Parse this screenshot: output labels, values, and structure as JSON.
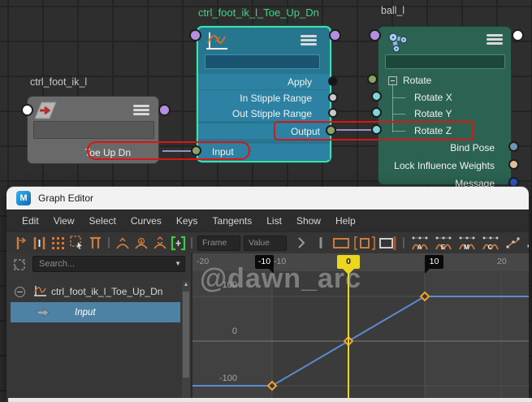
{
  "watermark": "@dawn_arc",
  "colors": {
    "selection_green": "#44e2a2",
    "highlight_red": "#de1414",
    "curve_blue": "#5b8ad0",
    "key_orange": "#f1a525",
    "playhead_yellow": "#ecd61e",
    "connection_lavender": "#9a90c8"
  },
  "icons": {
    "dropdown_caret": "▼",
    "scroll_up": "▲"
  },
  "node_editor": {
    "nodes": {
      "ctrl": {
        "title": "ctrl_foot_ik_l",
        "attr_toe": "Toe Up Dn"
      },
      "anim": {
        "title": "ctrl_foot_ik_l_Toe_Up_Dn",
        "attrs": [
          "Apply",
          "In Stipple Range",
          "Out Stipple Range",
          "Output",
          "Input"
        ]
      },
      "ball": {
        "title": "ball_l",
        "attrs": [
          "Rotate",
          "Rotate X",
          "Rotate Y",
          "Rotate Z",
          "Bind Pose",
          "Lock Influence Weights",
          "Message"
        ]
      }
    }
  },
  "graph_editor": {
    "window_title": "Graph Editor",
    "maya_icon_letter": "M",
    "menus": [
      "Edit",
      "View",
      "Select",
      "Curves",
      "Keys",
      "Tangents",
      "List",
      "Show",
      "Help"
    ],
    "toolbar": {
      "frame_label": "Frame",
      "value_label": "Value",
      "tangent_letters": [
        "A",
        "E",
        "M",
        "C"
      ]
    },
    "outliner": {
      "search_placeholder": "Search...",
      "curve_node": "ctrl_foot_ik_l_Toe_Up_Dn",
      "channel": "Input"
    },
    "ruler": {
      "left_label": "-20",
      "neg10_label": "-10",
      "right_label": "20",
      "bookmark_left": "-10",
      "bookmark_right": "10",
      "current_time": "0"
    },
    "value_axis": [
      "100",
      "0",
      "-100"
    ],
    "chart_data": {
      "type": "line",
      "curve": "ctrl_foot_ik_l_Toe_Up_Dn.Input",
      "x": [
        -10,
        0,
        10
      ],
      "values": [
        -100,
        0,
        100
      ],
      "interpolation": "linear",
      "pre_infinity": "constant",
      "post_infinity": "constant",
      "current_time": 0,
      "xlim": [
        -22,
        22
      ],
      "ylim": [
        -140,
        160
      ],
      "grid": true
    }
  }
}
